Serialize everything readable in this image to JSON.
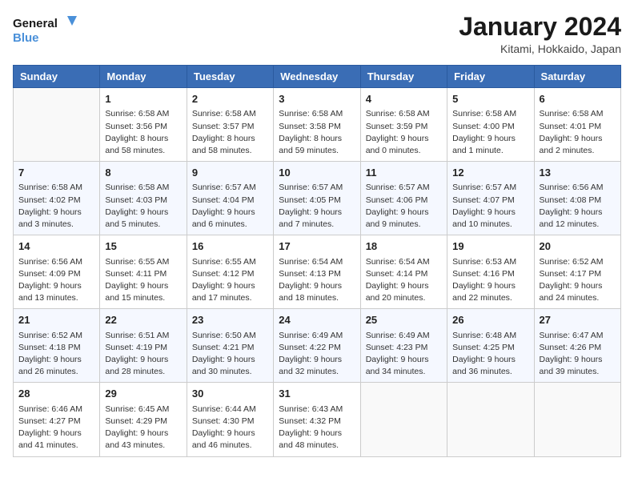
{
  "header": {
    "logo_line1": "General",
    "logo_line2": "Blue",
    "title": "January 2024",
    "subtitle": "Kitami, Hokkaido, Japan"
  },
  "days_header": [
    "Sunday",
    "Monday",
    "Tuesday",
    "Wednesday",
    "Thursday",
    "Friday",
    "Saturday"
  ],
  "weeks": [
    [
      {
        "day": "",
        "info": ""
      },
      {
        "day": "1",
        "info": "Sunrise: 6:58 AM\nSunset: 3:56 PM\nDaylight: 8 hours\nand 58 minutes."
      },
      {
        "day": "2",
        "info": "Sunrise: 6:58 AM\nSunset: 3:57 PM\nDaylight: 8 hours\nand 58 minutes."
      },
      {
        "day": "3",
        "info": "Sunrise: 6:58 AM\nSunset: 3:58 PM\nDaylight: 8 hours\nand 59 minutes."
      },
      {
        "day": "4",
        "info": "Sunrise: 6:58 AM\nSunset: 3:59 PM\nDaylight: 9 hours\nand 0 minutes."
      },
      {
        "day": "5",
        "info": "Sunrise: 6:58 AM\nSunset: 4:00 PM\nDaylight: 9 hours\nand 1 minute."
      },
      {
        "day": "6",
        "info": "Sunrise: 6:58 AM\nSunset: 4:01 PM\nDaylight: 9 hours\nand 2 minutes."
      }
    ],
    [
      {
        "day": "7",
        "info": "Sunrise: 6:58 AM\nSunset: 4:02 PM\nDaylight: 9 hours\nand 3 minutes."
      },
      {
        "day": "8",
        "info": "Sunrise: 6:58 AM\nSunset: 4:03 PM\nDaylight: 9 hours\nand 5 minutes."
      },
      {
        "day": "9",
        "info": "Sunrise: 6:57 AM\nSunset: 4:04 PM\nDaylight: 9 hours\nand 6 minutes."
      },
      {
        "day": "10",
        "info": "Sunrise: 6:57 AM\nSunset: 4:05 PM\nDaylight: 9 hours\nand 7 minutes."
      },
      {
        "day": "11",
        "info": "Sunrise: 6:57 AM\nSunset: 4:06 PM\nDaylight: 9 hours\nand 9 minutes."
      },
      {
        "day": "12",
        "info": "Sunrise: 6:57 AM\nSunset: 4:07 PM\nDaylight: 9 hours\nand 10 minutes."
      },
      {
        "day": "13",
        "info": "Sunrise: 6:56 AM\nSunset: 4:08 PM\nDaylight: 9 hours\nand 12 minutes."
      }
    ],
    [
      {
        "day": "14",
        "info": "Sunrise: 6:56 AM\nSunset: 4:09 PM\nDaylight: 9 hours\nand 13 minutes."
      },
      {
        "day": "15",
        "info": "Sunrise: 6:55 AM\nSunset: 4:11 PM\nDaylight: 9 hours\nand 15 minutes."
      },
      {
        "day": "16",
        "info": "Sunrise: 6:55 AM\nSunset: 4:12 PM\nDaylight: 9 hours\nand 17 minutes."
      },
      {
        "day": "17",
        "info": "Sunrise: 6:54 AM\nSunset: 4:13 PM\nDaylight: 9 hours\nand 18 minutes."
      },
      {
        "day": "18",
        "info": "Sunrise: 6:54 AM\nSunset: 4:14 PM\nDaylight: 9 hours\nand 20 minutes."
      },
      {
        "day": "19",
        "info": "Sunrise: 6:53 AM\nSunset: 4:16 PM\nDaylight: 9 hours\nand 22 minutes."
      },
      {
        "day": "20",
        "info": "Sunrise: 6:52 AM\nSunset: 4:17 PM\nDaylight: 9 hours\nand 24 minutes."
      }
    ],
    [
      {
        "day": "21",
        "info": "Sunrise: 6:52 AM\nSunset: 4:18 PM\nDaylight: 9 hours\nand 26 minutes."
      },
      {
        "day": "22",
        "info": "Sunrise: 6:51 AM\nSunset: 4:19 PM\nDaylight: 9 hours\nand 28 minutes."
      },
      {
        "day": "23",
        "info": "Sunrise: 6:50 AM\nSunset: 4:21 PM\nDaylight: 9 hours\nand 30 minutes."
      },
      {
        "day": "24",
        "info": "Sunrise: 6:49 AM\nSunset: 4:22 PM\nDaylight: 9 hours\nand 32 minutes."
      },
      {
        "day": "25",
        "info": "Sunrise: 6:49 AM\nSunset: 4:23 PM\nDaylight: 9 hours\nand 34 minutes."
      },
      {
        "day": "26",
        "info": "Sunrise: 6:48 AM\nSunset: 4:25 PM\nDaylight: 9 hours\nand 36 minutes."
      },
      {
        "day": "27",
        "info": "Sunrise: 6:47 AM\nSunset: 4:26 PM\nDaylight: 9 hours\nand 39 minutes."
      }
    ],
    [
      {
        "day": "28",
        "info": "Sunrise: 6:46 AM\nSunset: 4:27 PM\nDaylight: 9 hours\nand 41 minutes."
      },
      {
        "day": "29",
        "info": "Sunrise: 6:45 AM\nSunset: 4:29 PM\nDaylight: 9 hours\nand 43 minutes."
      },
      {
        "day": "30",
        "info": "Sunrise: 6:44 AM\nSunset: 4:30 PM\nDaylight: 9 hours\nand 46 minutes."
      },
      {
        "day": "31",
        "info": "Sunrise: 6:43 AM\nSunset: 4:32 PM\nDaylight: 9 hours\nand 48 minutes."
      },
      {
        "day": "",
        "info": ""
      },
      {
        "day": "",
        "info": ""
      },
      {
        "day": "",
        "info": ""
      }
    ]
  ]
}
